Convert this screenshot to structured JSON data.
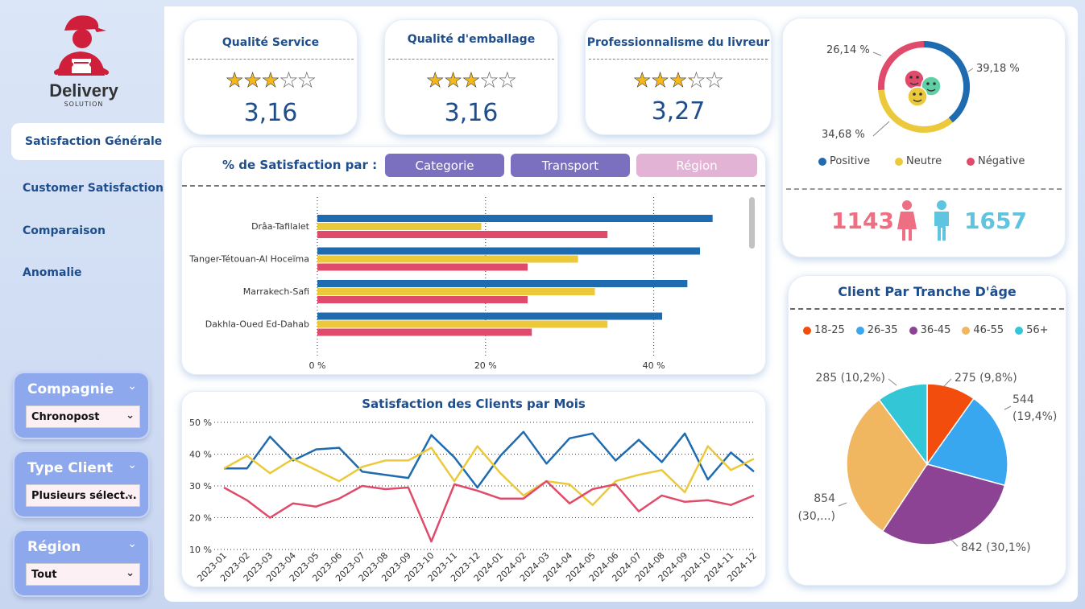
{
  "brand": {
    "name": "Delivery",
    "tagline": "SOLUTION"
  },
  "nav": {
    "items": [
      {
        "label": "Satisfaction Générale"
      },
      {
        "label": "Customer Satisfaction"
      },
      {
        "label": "Comparaison"
      },
      {
        "label": "Anomalie"
      }
    ]
  },
  "slicers": [
    {
      "title": "Compagnie",
      "value": "Chronopost"
    },
    {
      "title": "Type Client",
      "value": "Plusieurs sélect..."
    },
    {
      "title": "Région",
      "value": "Tout"
    }
  ],
  "kpis": [
    {
      "title": "Qualité Service",
      "value": "3,16",
      "rating": 3.16
    },
    {
      "title": "Qualité d'emballage",
      "value": "3,16",
      "rating": 3.16
    },
    {
      "title": "Professionnalisme du livreur",
      "value": "3,27",
      "rating": 3.27
    }
  ],
  "satisfaction_panel": {
    "title": "% de Satisfaction par :",
    "buttons": [
      {
        "label": "Categorie",
        "color": "#7b6fc0"
      },
      {
        "label": "Transport",
        "color": "#7b6fc0"
      },
      {
        "label": "Région",
        "color": "#e2b3d4"
      }
    ]
  },
  "sentiment": {
    "labels": {
      "positive": "39,18 %",
      "neutral": "34,68 %",
      "negative": "26,14 %"
    },
    "legend": [
      {
        "label": "Positive",
        "color": "#1f6bb0"
      },
      {
        "label": "Neutre",
        "color": "#ecc93a"
      },
      {
        "label": "Négative",
        "color": "#e04a6b"
      }
    ]
  },
  "gender": {
    "female": "1143",
    "male": "1657",
    "female_color": "#ef6f82",
    "male_color": "#5ec4e0"
  },
  "age_panel": {
    "title": "Client Par Tranche D'âge"
  },
  "chart_data": [
    {
      "type": "bar",
      "orientation": "horizontal",
      "categories": [
        "Drâa-Tafilalet",
        "Tanger-Tétouan-Al Hoceïma",
        "Marrakech-Safi",
        "Dakhla-Oued Ed-Dahab"
      ],
      "series": [
        {
          "values": [
            47,
            45.5,
            44,
            41
          ],
          "color": "#1f6bb0"
        },
        {
          "values": [
            19.5,
            31,
            33,
            34.5
          ],
          "color": "#ecc93a"
        },
        {
          "values": [
            34.5,
            25,
            25,
            25.5
          ],
          "color": "#e04a6b"
        }
      ],
      "x_ticks": [
        "0 %",
        "20 %",
        "40 %"
      ],
      "xlim": [
        0,
        50
      ],
      "grid": "vertical-dotted"
    },
    {
      "type": "donut",
      "values": [
        39.18,
        34.68,
        26.14
      ],
      "colors": [
        "#1f6bb0",
        "#ecc93a",
        "#e04a6b"
      ]
    },
    {
      "type": "line",
      "title": "Satisfaction des Clients par Mois",
      "x": [
        "2023-01",
        "2023-02",
        "2023-03",
        "2023-04",
        "2023-05",
        "2023-06",
        "2023-07",
        "2023-08",
        "2023-09",
        "2023-10",
        "2023-11",
        "2023-12",
        "2024-01",
        "2024-02",
        "2024-03",
        "2024-04",
        "2024-05",
        "2024-06",
        "2024-07",
        "2024-08",
        "2024-09",
        "2024-10",
        "2024-11",
        "2024-12"
      ],
      "series": [
        {
          "color": "#1f6bb0",
          "values": [
            35.5,
            35.5,
            45.5,
            38,
            41.5,
            42,
            34.5,
            33.5,
            32.5,
            46,
            39,
            29.5,
            39.5,
            47,
            37,
            45,
            46.5,
            38,
            44.5,
            37.5,
            46.5,
            32,
            40.5,
            34.5
          ]
        },
        {
          "color": "#ecc93a",
          "values": [
            35.5,
            39.5,
            34,
            38.5,
            35,
            31.5,
            36,
            38,
            38,
            42,
            31.5,
            42.5,
            34,
            27,
            31.5,
            30.5,
            24,
            31.5,
            33.5,
            35,
            28,
            42.5,
            35,
            38.5
          ]
        },
        {
          "color": "#e04a6b",
          "values": [
            29.5,
            25.5,
            20,
            24.5,
            23.5,
            26,
            30,
            29,
            29.5,
            12.5,
            30.5,
            28.5,
            26,
            26,
            31.5,
            24.5,
            29,
            30.5,
            22,
            27,
            25,
            25.5,
            24,
            27
          ]
        }
      ],
      "ylim": [
        10,
        50
      ],
      "y_ticks": [
        "10 %",
        "20 %",
        "30 %",
        "40 %",
        "50 %"
      ],
      "grid": "horizontal-dotted"
    },
    {
      "type": "pie",
      "title": "Client Par Tranche D'âge",
      "legend": [
        "18-25",
        "26-35",
        "36-45",
        "46-55",
        "56+"
      ],
      "values": [
        275,
        544,
        842,
        854,
        285
      ],
      "colors": [
        "#f24d0c",
        "#39a7f0",
        "#8c4394",
        "#f0b660",
        "#33c6d6"
      ],
      "data_labels": [
        "275 (9,8%)",
        "544",
        "(19,4%)",
        "842 (30,1%)",
        "854",
        "(30,...)",
        "285 (10,2%)"
      ]
    }
  ]
}
